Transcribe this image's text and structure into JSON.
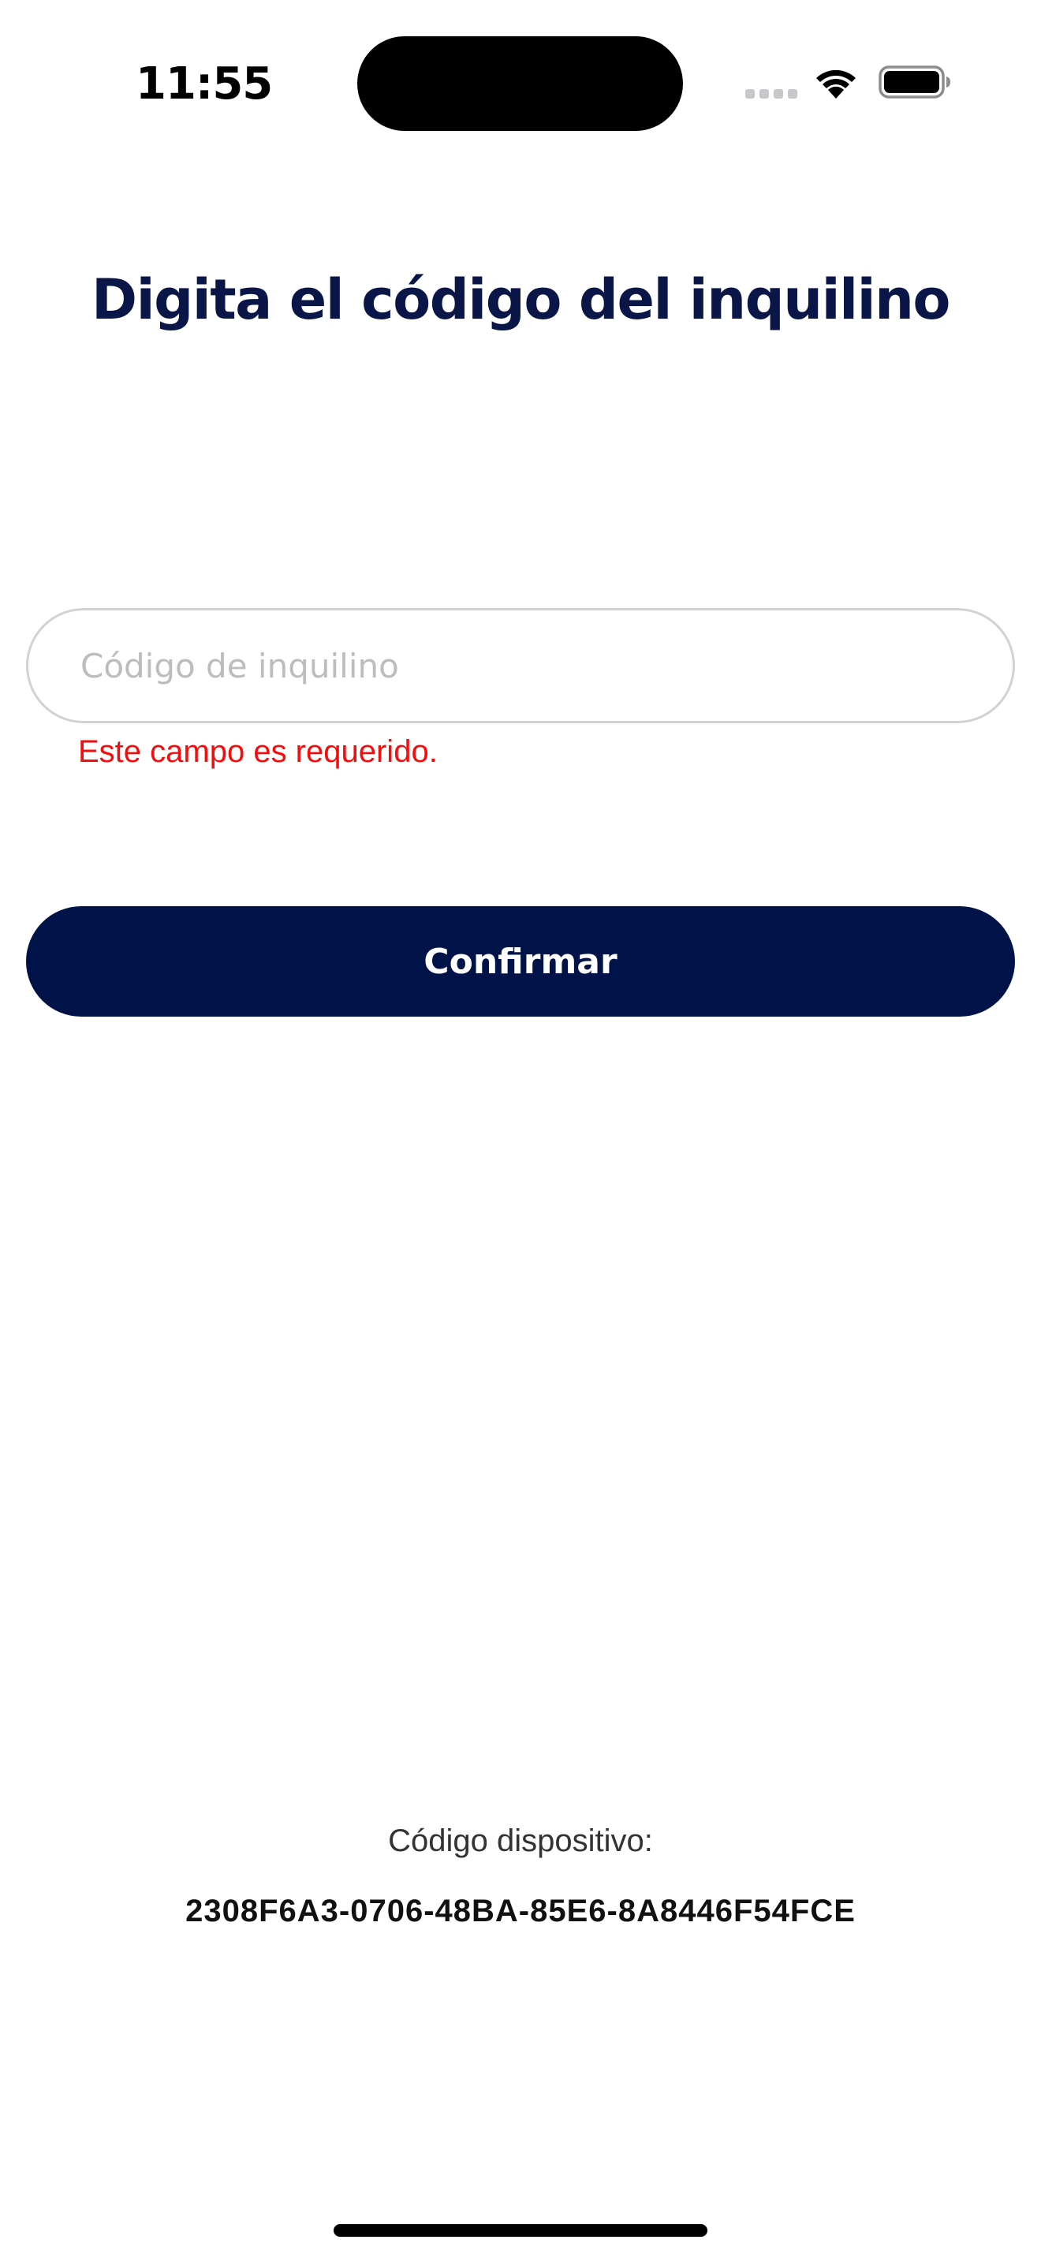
{
  "status_bar": {
    "time": "11:55",
    "icons": [
      "cellular-signal-icon",
      "wifi-icon",
      "battery-icon"
    ]
  },
  "page": {
    "title": "Digita el código del inquilino"
  },
  "form": {
    "tenant_code": {
      "value": "",
      "placeholder": "Código de inquilino",
      "error": "Este campo es requerido."
    },
    "confirm_label": "Confirmar"
  },
  "device": {
    "label": "Código dispositivo:",
    "id": "2308F6A3-0706-48BA-85E6-8A8446F54FCE"
  },
  "colors": {
    "primary": "#001348",
    "title": "#0a1648",
    "error": "#f50c0c",
    "input_border": "#d2d2d2",
    "placeholder": "#bdbdbd"
  }
}
